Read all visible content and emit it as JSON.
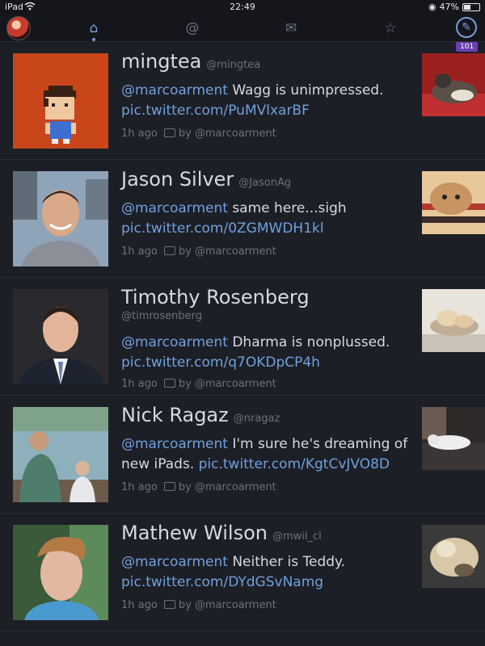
{
  "status_bar": {
    "carrier": "iPad",
    "time": "22:49",
    "battery_text": "47%",
    "battery_level": 0.47
  },
  "toolbar": {
    "tabs": [
      {
        "icon": "home-icon",
        "glyph": "⌂"
      },
      {
        "icon": "mentions-icon",
        "glyph": "@"
      },
      {
        "icon": "messages-icon",
        "glyph": "✉"
      },
      {
        "icon": "favorites-icon",
        "glyph": "☆"
      }
    ],
    "compose_icon": "compose-icon",
    "unread_badge": "101"
  },
  "tweets": [
    {
      "name": "mingtea",
      "handle": "@mingtea",
      "mention": "@marcoarment",
      "text": " Wagg is unimpressed.",
      "link": "pic.twitter.com/PuMVlxarBF",
      "time": "1h ago",
      "retweeted_by": "by @marcoarment"
    },
    {
      "name": "Jason Silver",
      "handle": "@JasonAg",
      "mention": "@marcoarment",
      "text": " same here...sigh",
      "link": "pic.twitter.com/0ZGMWDH1kl",
      "time": "1h ago",
      "retweeted_by": "by @marcoarment"
    },
    {
      "name": "Timothy Rosenberg",
      "handle": "@timrosenberg",
      "mention": "@marcoarment",
      "text": " Dharma is nonplussed.",
      "link": "pic.twitter.com/q7OKDpCP4h",
      "time": "1h ago",
      "retweeted_by": "by @marcoarment"
    },
    {
      "name": "Nick Ragaz",
      "handle": "@nragaz",
      "mention": "@marcoarment",
      "text": " I'm sure he's dreaming of new iPads. ",
      "link": "pic.twitter.com/KgtCvJVO8D",
      "time": "1h ago",
      "retweeted_by": "by @marcoarment"
    },
    {
      "name": "Mathew Wilson",
      "handle": "@mwil_cl",
      "mention": "@marcoarment",
      "text": " Neither is Teddy.",
      "link": "pic.twitter.com/DYdGSvNamg",
      "time": "1h ago",
      "retweeted_by": "by @marcoarment"
    }
  ]
}
